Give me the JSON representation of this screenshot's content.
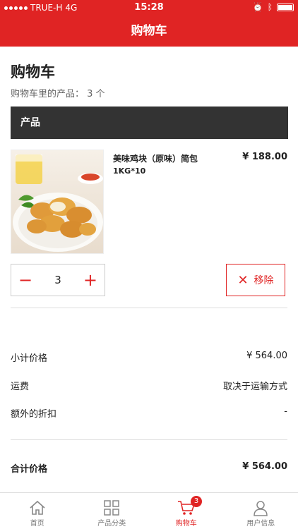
{
  "status_bar": {
    "carrier": "TRUE-H",
    "network": "4G",
    "time": "15:28"
  },
  "navbar": {
    "title": "购物车"
  },
  "page": {
    "title": "购物车",
    "count_label": "购物车里的产品：",
    "count_value": "3 个",
    "section_header": "产品"
  },
  "item": {
    "name": "美味鸡块（原味）简包",
    "spec": "1KG*10",
    "price": "¥ 188.00",
    "quantity": "3",
    "minus": "−",
    "plus": "+",
    "remove_label": "移除",
    "remove_icon": "✕"
  },
  "summary": {
    "subtotal_label": "小计价格",
    "subtotal_value": "¥ 564.00",
    "shipping_label": "运费",
    "shipping_value": "取决于运输方式",
    "discount_label": "额外的折扣",
    "discount_value": "-",
    "total_label": "合计价格",
    "total_value": "¥ 564.00"
  },
  "tabs": [
    {
      "label": "首页",
      "icon": "home-icon"
    },
    {
      "label": "产品分类",
      "icon": "grid-icon"
    },
    {
      "label": "购物车",
      "icon": "cart-icon",
      "badge": "3",
      "active": true
    },
    {
      "label": "用户信息",
      "icon": "user-icon"
    }
  ],
  "colors": {
    "accent": "#e02424",
    "header_dark": "#333333"
  }
}
